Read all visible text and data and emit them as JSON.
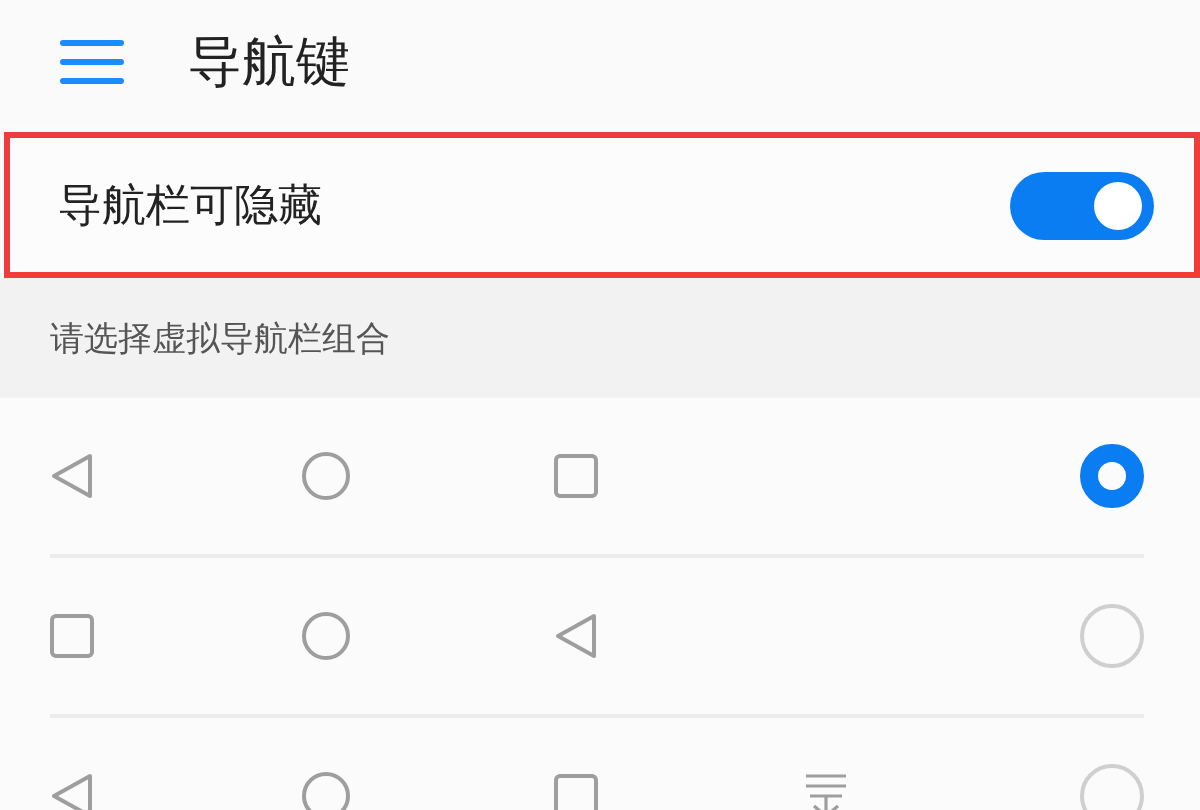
{
  "header": {
    "title": "导航键"
  },
  "hide_setting": {
    "label": "导航栏可隐藏",
    "on": true,
    "highlighted": true
  },
  "section": {
    "title": "请选择虚拟导航栏组合"
  },
  "combinations": [
    {
      "selected": true,
      "keys": [
        {
          "kind": "back"
        },
        {
          "kind": "home"
        },
        {
          "kind": "recent"
        }
      ]
    },
    {
      "selected": false,
      "keys": [
        {
          "kind": "recent"
        },
        {
          "kind": "home"
        },
        {
          "kind": "back"
        }
      ]
    },
    {
      "selected": false,
      "keys": [
        {
          "kind": "back"
        },
        {
          "kind": "home"
        },
        {
          "kind": "recent"
        },
        {
          "kind": "pulldown"
        }
      ]
    }
  ]
}
